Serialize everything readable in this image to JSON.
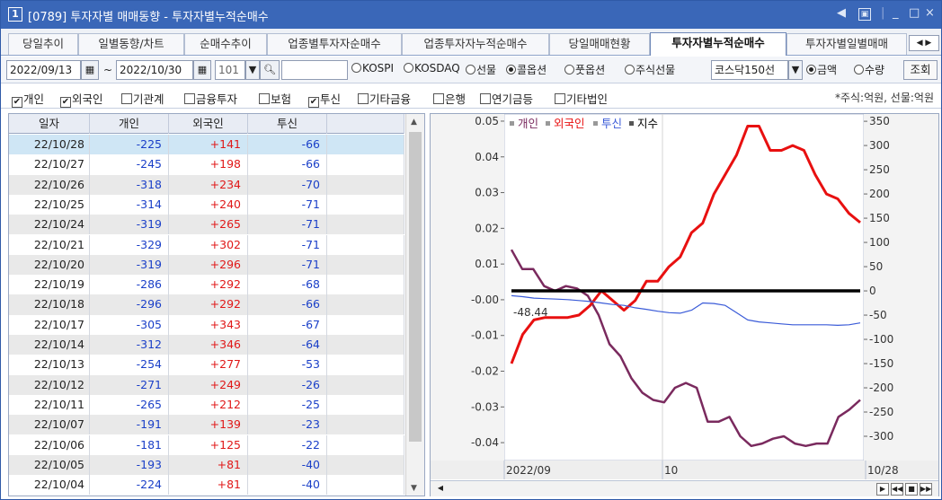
{
  "window": {
    "number": "1",
    "title": "[0789] 투자자별 매매동향 - 투자자별누적순매수",
    "controls": {
      "prev": "◀",
      "restore": "▣",
      "min": "_",
      "max": "□",
      "close": "×"
    }
  },
  "tabs": [
    "당일추이",
    "일별동향/차트",
    "순매수추이",
    "업종별투자자순매수",
    "업종투자자누적순매수",
    "당일매매현황",
    "투자자별누적순매수",
    "투자자별일별매매"
  ],
  "active_tab": "투자자별누적순매수",
  "tab_nav": "◀ ▶",
  "controls": {
    "start_date": "2022/09/13",
    "tilde": "~",
    "end_date": "2022/10/30",
    "code": "101",
    "code_input": "",
    "radios_market": [
      {
        "label": "KOSPI",
        "checked": false
      },
      {
        "label": "KOSDAQ",
        "checked": false
      },
      {
        "label": "선물",
        "checked": false
      },
      {
        "label": "콜옵션",
        "checked": true
      },
      {
        "label": "풋옵션",
        "checked": false
      },
      {
        "label": "주식선물",
        "checked": false
      }
    ],
    "select_value": "코스닥150선",
    "radios_unit": [
      {
        "label": "금액",
        "checked": true
      },
      {
        "label": "수량",
        "checked": false
      }
    ],
    "search_button": "조회"
  },
  "checkboxes": [
    {
      "label": "개인",
      "checked": true
    },
    {
      "label": "외국인",
      "checked": true
    },
    {
      "label": "기관계",
      "checked": false
    },
    {
      "label": "금융투자",
      "checked": false
    },
    {
      "label": "보험",
      "checked": false
    },
    {
      "label": "투신",
      "checked": true
    },
    {
      "label": "기타금융",
      "checked": false
    },
    {
      "label": "은행",
      "checked": false
    },
    {
      "label": "연기금등",
      "checked": false
    },
    {
      "label": "기타법인",
      "checked": false
    }
  ],
  "unit_note": "*주식:억원, 선물:억원",
  "table": {
    "headers": [
      "일자",
      "개인",
      "외국인",
      "투신"
    ],
    "rows": [
      [
        "22/10/28",
        "-225",
        "+141",
        "-66"
      ],
      [
        "22/10/27",
        "-245",
        "+198",
        "-66"
      ],
      [
        "22/10/26",
        "-318",
        "+234",
        "-70"
      ],
      [
        "22/10/25",
        "-314",
        "+240",
        "-71"
      ],
      [
        "22/10/24",
        "-319",
        "+265",
        "-71"
      ],
      [
        "22/10/21",
        "-329",
        "+302",
        "-71"
      ],
      [
        "22/10/20",
        "-319",
        "+296",
        "-71"
      ],
      [
        "22/10/19",
        "-286",
        "+292",
        "-68"
      ],
      [
        "22/10/18",
        "-296",
        "+292",
        "-66"
      ],
      [
        "22/10/17",
        "-305",
        "+343",
        "-67"
      ],
      [
        "22/10/14",
        "-312",
        "+346",
        "-64"
      ],
      [
        "22/10/13",
        "-254",
        "+277",
        "-53"
      ],
      [
        "22/10/12",
        "-271",
        "+249",
        "-26"
      ],
      [
        "22/10/11",
        "-265",
        "+212",
        "-25"
      ],
      [
        "22/10/07",
        "-191",
        "+139",
        "-23"
      ],
      [
        "22/10/06",
        "-181",
        "+125",
        "-22"
      ],
      [
        "22/10/05",
        "-193",
        "+81",
        "-40"
      ],
      [
        "22/10/04",
        "-224",
        "+81",
        "-40"
      ]
    ]
  },
  "chart_data": {
    "type": "line",
    "legend": [
      {
        "name": "개인",
        "color": "#7a2a5e"
      },
      {
        "name": "외국인",
        "color": "#e81010"
      },
      {
        "name": "투신",
        "color": "#3a5bd8"
      },
      {
        "name": "지수",
        "color": "#000000"
      }
    ],
    "left_ticks": [
      "0.05",
      "0.04",
      "0.03",
      "0.02",
      "0.01",
      "-0.00",
      "-0.01",
      "-0.02",
      "-0.03",
      "-0.04"
    ],
    "right_ticks": [
      "350",
      "300",
      "250",
      "200",
      "150",
      "100",
      "50",
      "0",
      "-50",
      "-100",
      "-150",
      "-200",
      "-250",
      "-300"
    ],
    "ylim_left": [
      -0.045,
      0.052
    ],
    "ylim_right": [
      -350,
      365
    ],
    "x_labels": [
      "2022/09",
      "10",
      "10/28"
    ],
    "cursor_label": "-48.44",
    "series": [
      {
        "name": "개인",
        "axis": "right",
        "values": [
          85,
          45,
          45,
          10,
          0,
          10,
          5,
          -10,
          -50,
          -110,
          -135,
          -180,
          -210,
          -225,
          -230,
          -200,
          -190,
          -200,
          -270,
          -270,
          -260,
          -300,
          -320,
          -315,
          -305,
          -300,
          -315,
          -320,
          -315,
          -315,
          -260,
          -245,
          -225
        ]
      },
      {
        "name": "외국인",
        "axis": "right",
        "values": [
          -150,
          -90,
          -60,
          -55,
          -55,
          -55,
          -50,
          -30,
          0,
          -20,
          -40,
          -20,
          20,
          20,
          50,
          70,
          120,
          140,
          200,
          240,
          280,
          340,
          340,
          290,
          290,
          300,
          290,
          240,
          200,
          190,
          160,
          141
        ]
      },
      {
        "name": "투신",
        "axis": "right",
        "values": [
          -10,
          -12,
          -15,
          -16,
          -17,
          -18,
          -20,
          -22,
          -25,
          -28,
          -30,
          -35,
          -38,
          -42,
          -45,
          -46,
          -40,
          -25,
          -26,
          -30,
          -45,
          -60,
          -64,
          -66,
          -68,
          -70,
          -70,
          -70,
          -70,
          -71,
          -70,
          -66
        ]
      },
      {
        "name": "지수",
        "axis": "right",
        "values": [
          0,
          0,
          0,
          0,
          0,
          0,
          0,
          0,
          0,
          0,
          0,
          0,
          0,
          0,
          0,
          0,
          0,
          0,
          0,
          0,
          0,
          0,
          0,
          0,
          0,
          0,
          0,
          0,
          0,
          0,
          0,
          0
        ]
      }
    ]
  },
  "chart_bottom": {
    "first": "◀",
    "nav": [
      "▶",
      "◀◀",
      "■",
      "▶▶"
    ]
  }
}
